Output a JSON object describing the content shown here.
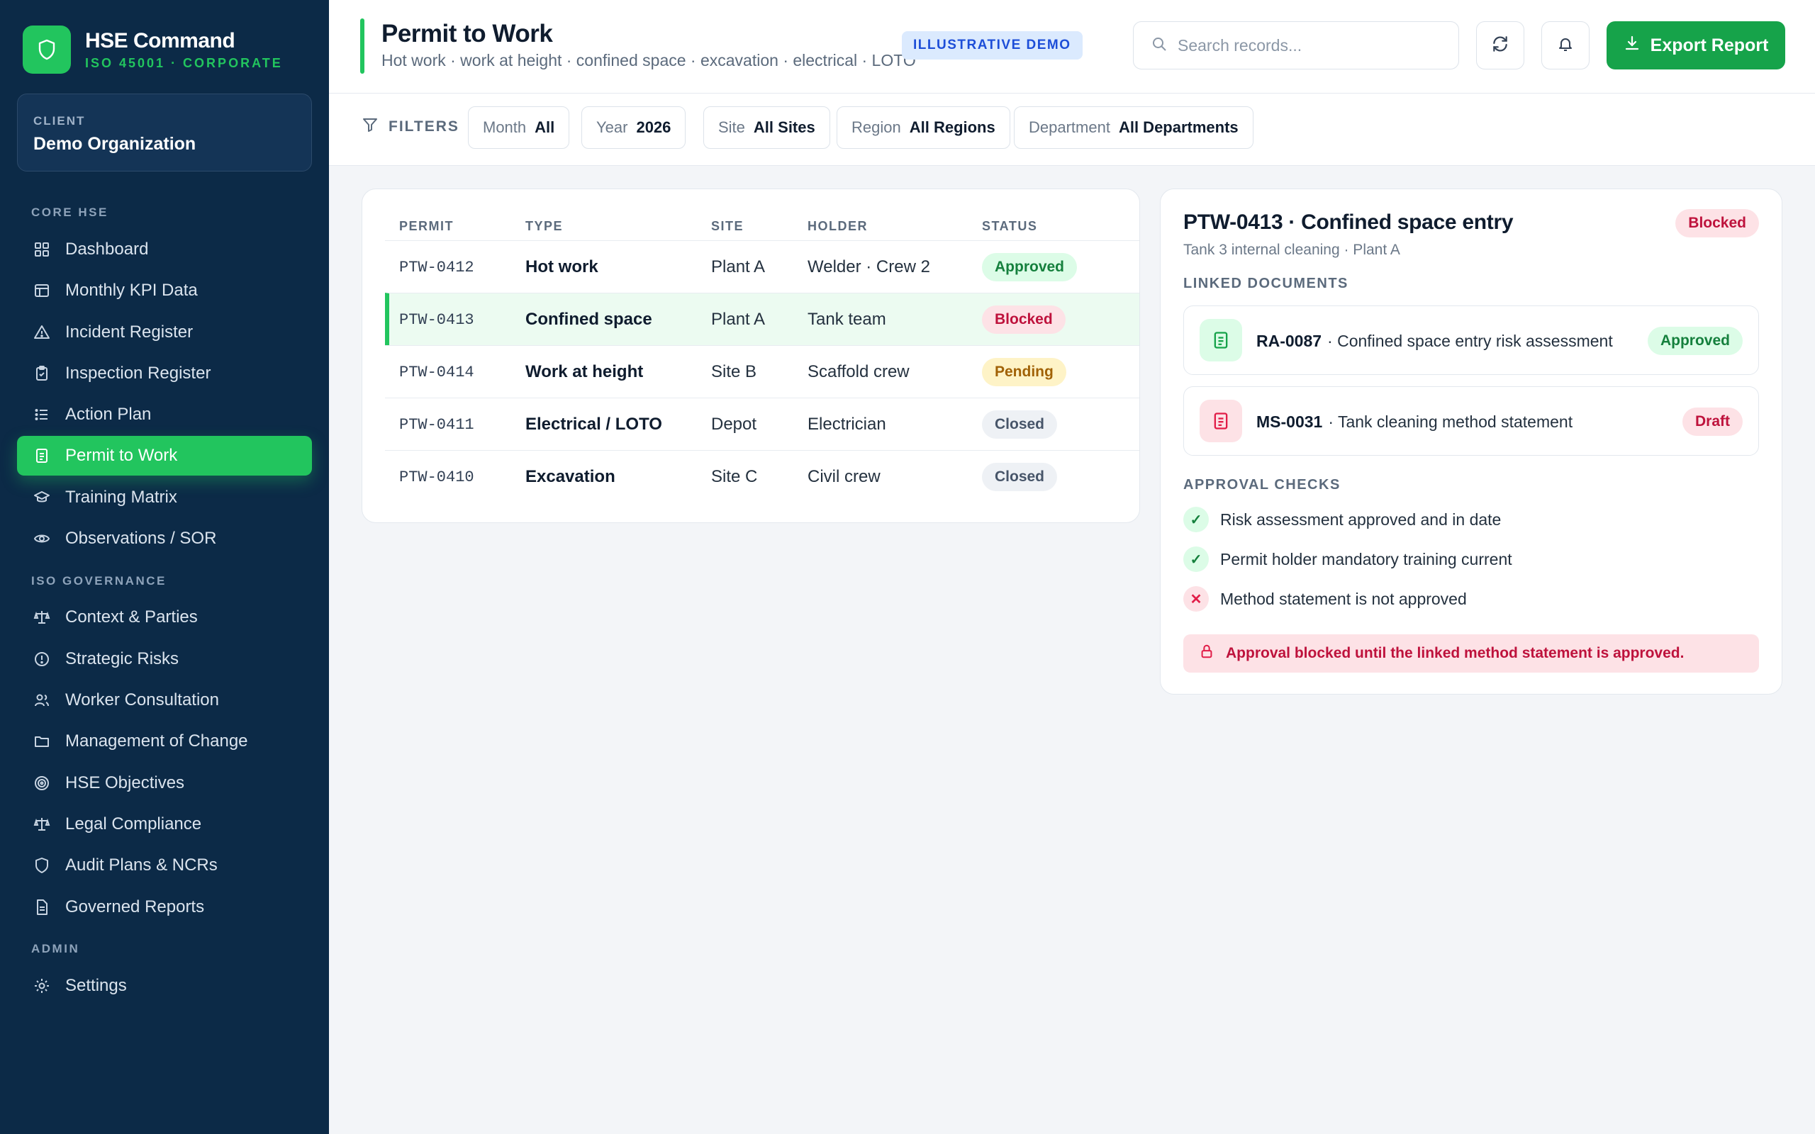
{
  "brand": {
    "title": "HSE Command",
    "subtitle": "ISO 45001 · CORPORATE"
  },
  "client": {
    "label": "CLIENT",
    "name": "Demo Organization"
  },
  "nav": {
    "sections": [
      "CORE HSE",
      "ISO GOVERNANCE",
      "ADMIN"
    ],
    "items": [
      {
        "label": "Dashboard",
        "icon": "grid-icon"
      },
      {
        "label": "Monthly KPI Data",
        "icon": "table-icon"
      },
      {
        "label": "Incident Register",
        "icon": "warning-icon"
      },
      {
        "label": "Inspection Register",
        "icon": "clipboard-check-icon"
      },
      {
        "label": "Action Plan",
        "icon": "list-icon"
      },
      {
        "label": "Permit to Work",
        "icon": "document-icon",
        "active": true
      },
      {
        "label": "Training Matrix",
        "icon": "graduation-cap-icon"
      },
      {
        "label": "Observations / SOR",
        "icon": "eye-icon"
      },
      {
        "label": "Context & Parties",
        "icon": "scale-icon"
      },
      {
        "label": "Strategic Risks",
        "icon": "alert-circle-icon"
      },
      {
        "label": "Worker Consultation",
        "icon": "users-icon"
      },
      {
        "label": "Management of Change",
        "icon": "folder-icon"
      },
      {
        "label": "HSE Objectives",
        "icon": "target-icon"
      },
      {
        "label": "Legal Compliance",
        "icon": "scale-icon"
      },
      {
        "label": "Audit Plans & NCRs",
        "icon": "shield-icon"
      },
      {
        "label": "Governed Reports",
        "icon": "file-icon"
      },
      {
        "label": "Settings",
        "icon": "gear-icon"
      }
    ]
  },
  "header": {
    "title": "Permit to Work",
    "subtitle": "Hot work · work at height · confined space · excavation · electrical · LOTO",
    "badge": "ILLUSTRATIVE DEMO",
    "search_placeholder": "Search records...",
    "export_label": "Export Report"
  },
  "filters": {
    "label": "FILTERS",
    "chips": [
      {
        "key": "Month",
        "value": "All"
      },
      {
        "key": "Year",
        "value": "2026"
      },
      {
        "key": "Site",
        "value": "All Sites"
      },
      {
        "key": "Region",
        "value": "All Regions"
      },
      {
        "key": "Department",
        "value": "All Departments"
      }
    ]
  },
  "table": {
    "columns": [
      "PERMIT",
      "TYPE",
      "SITE",
      "HOLDER",
      "STATUS"
    ],
    "rows": [
      {
        "permit": "PTW-0412",
        "type": "Hot work",
        "site": "Plant A",
        "holder": "Welder · Crew 2",
        "status": "Approved"
      },
      {
        "permit": "PTW-0413",
        "type": "Confined space",
        "site": "Plant A",
        "holder": "Tank team",
        "status": "Blocked"
      },
      {
        "permit": "PTW-0414",
        "type": "Work at height",
        "site": "Site B",
        "holder": "Scaffold crew",
        "status": "Pending"
      },
      {
        "permit": "PTW-0411",
        "type": "Electrical / LOTO",
        "site": "Depot",
        "holder": "Electrician",
        "status": "Closed"
      },
      {
        "permit": "PTW-0410",
        "type": "Excavation",
        "site": "Site C",
        "holder": "Civil crew",
        "status": "Closed"
      }
    ]
  },
  "detail": {
    "title": "PTW-0413 · Confined space entry",
    "subtitle": "Tank 3 internal cleaning · Plant A",
    "status": "Blocked",
    "linked_heading": "LINKED DOCUMENTS",
    "documents": [
      {
        "code": "RA-0087",
        "desc": "· Confined space entry risk assessment",
        "status": "Approved"
      },
      {
        "code": "MS-0031",
        "desc": "· Tank cleaning method statement",
        "status": "Draft"
      }
    ],
    "checks_heading": "APPROVAL CHECKS",
    "checks": [
      {
        "text": "Risk assessment approved and in date",
        "ok": true,
        "mark": "✓"
      },
      {
        "text": "Permit holder mandatory training current",
        "ok": true,
        "mark": "✓"
      },
      {
        "text": "Method statement is not approved",
        "ok": false,
        "mark": "✕"
      }
    ],
    "alert": "Approval blocked until the linked method statement is approved."
  },
  "colors": {
    "accent": "#22c55e",
    "sidebar": "#0c2a47",
    "export": "#16a34a",
    "danger": "#be123c"
  }
}
